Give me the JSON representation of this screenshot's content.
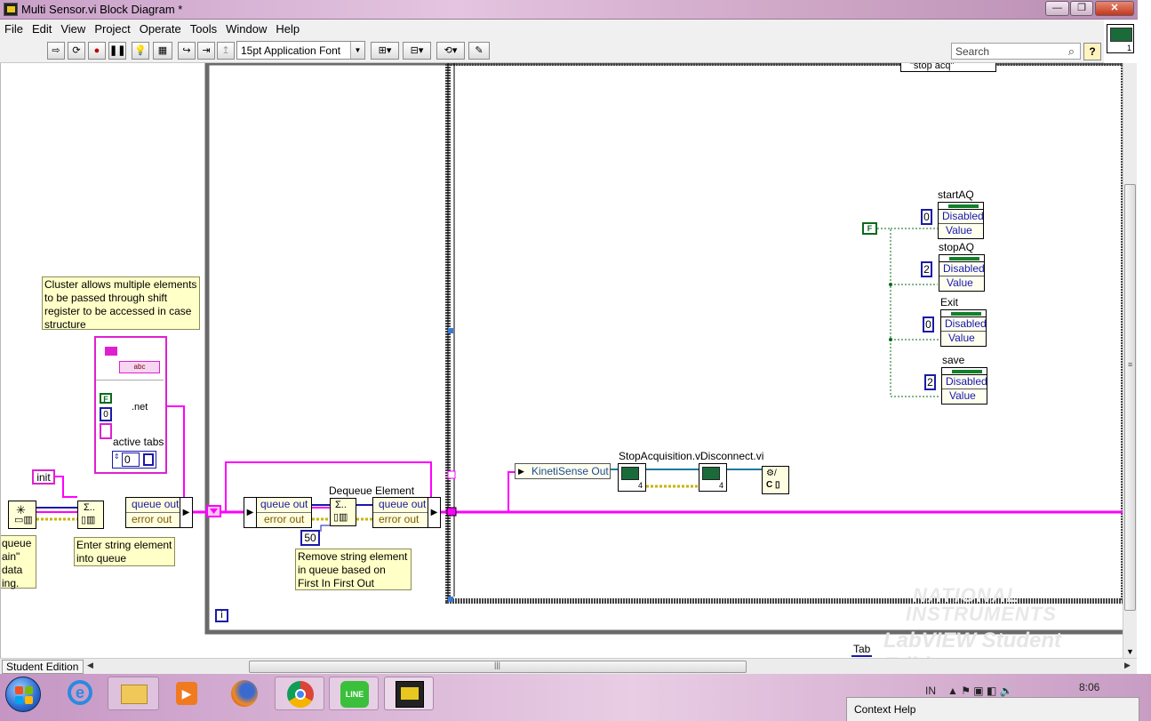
{
  "window": {
    "title": "Multi Sensor.vi Block Diagram *",
    "minimize_label": "—",
    "restore_label": "❐",
    "close_label": "✕"
  },
  "menu": [
    "File",
    "Edit",
    "View",
    "Project",
    "Operate",
    "Tools",
    "Window",
    "Help"
  ],
  "toolbar": {
    "font_value": "15pt Application Font",
    "search_placeholder": "Search",
    "search_icon": "magnifier-icon",
    "help_label": "?"
  },
  "diagram": {
    "case_selector_value": "\"stop acq\"",
    "comment_cluster": "Cluster allows multiple elements to be passed through shift register to be accessed in case structure",
    "comment_enter": "Enter string element into queue",
    "comment_remove": "Remove string element in queue based on First In First Out",
    "comment_left_partial": [
      "queue",
      "ain\"",
      "data",
      "ing."
    ],
    "init_const": "init",
    "active_tabs_label": "active tabs",
    "active_tabs_value": "0",
    "cluster_bool": "F",
    "cluster_num": "0",
    "cluster_string_glyph": "abc",
    "cluster_dotnet": ".net",
    "dequeue_label": "Dequeue Element",
    "timeout_const": "50",
    "loop_iteration": "i",
    "bundle_left": {
      "q": "queue out",
      "e": "error out"
    },
    "bundle_mid_left": {
      "q": "queue out",
      "e": "error out"
    },
    "bundle_mid_right": {
      "q": "queue out",
      "e": "error out"
    },
    "kineti_label": "KinetiSense Out",
    "stop_acq_label": "StopAcquisition.vi",
    "disconnect_label": "Disconnect.vi",
    "false_const": "F",
    "properties": [
      {
        "name": "startAQ",
        "index": "0",
        "disabled": "Disabled",
        "value": "Value"
      },
      {
        "name": "stopAQ",
        "index": "2",
        "disabled": "Disabled",
        "value": "Value"
      },
      {
        "name": "Exit",
        "index": "0",
        "disabled": "Disabled",
        "value": "Value"
      },
      {
        "name": "save",
        "index": "2",
        "disabled": "Disabled",
        "value": "Value"
      }
    ],
    "tab_label": "Tab",
    "watermark_line1": "NATIONAL",
    "watermark_line2": "INSTRUMENTS",
    "watermark_line3": "LabVIEW Student Edition"
  },
  "statusbar": {
    "edition": "Student Edition"
  },
  "taskbar": {
    "language": "IN",
    "clock": "8:06",
    "context_help": "Context Help",
    "start_icon": "windows-start-icon"
  },
  "colors": {
    "string_wire": "#ff00ff",
    "error_wire": "#c8b400",
    "numeric": "#1a1aa8",
    "boolean": "#0a6a1a",
    "note": "#ffffc8"
  }
}
